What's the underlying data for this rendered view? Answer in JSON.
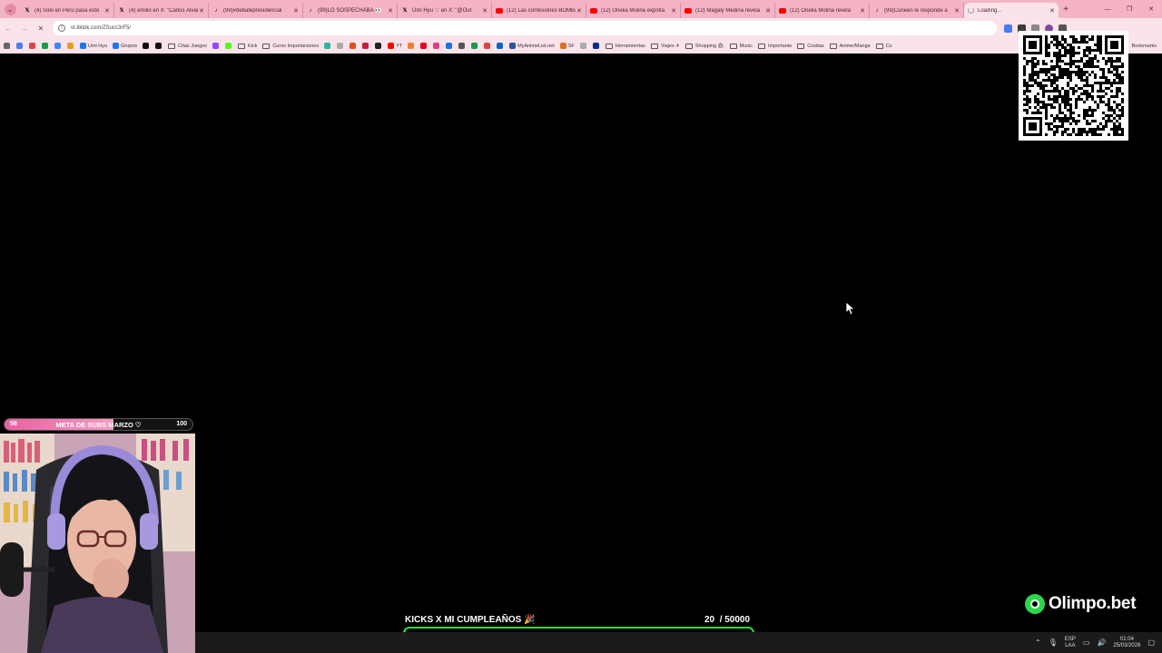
{
  "browser": {
    "tabs": [
      {
        "icon": "x",
        "title": "(4) Solo en Perú pasa esto"
      },
      {
        "icon": "x",
        "title": "(4) emilio en X: \"Carlos Álvarez"
      },
      {
        "icon": "tt",
        "title": "(99)#debatepresidencial"
      },
      {
        "icon": "tt",
        "title": "(99)LO SOSPECHABA 👀"
      },
      {
        "icon": "x",
        "title": "Umi Hyu ♡ en X: \"@Out"
      },
      {
        "icon": "yt",
        "title": "(12) Las confesiones BOMBA"
      },
      {
        "icon": "yt",
        "title": "(12) Onelia Molina explota"
      },
      {
        "icon": "yt",
        "title": "(12) Magaly Medina revela"
      },
      {
        "icon": "yt",
        "title": "(12) Onelia Molina revela"
      },
      {
        "icon": "tt",
        "title": "(99)Cuneen le responde a"
      },
      {
        "icon": "load",
        "title": "Loading...",
        "active": true
      }
    ],
    "address": "vt.tiktok.com/ZSucc3rF5/",
    "bookmarks": [
      {
        "kind": "icon",
        "color": "#4a7cf0"
      },
      {
        "kind": "icon",
        "color": "#d44"
      },
      {
        "kind": "icon",
        "color": "#1a9a4a"
      },
      {
        "kind": "icon",
        "color": "#4285f4"
      },
      {
        "kind": "icon",
        "color": "#e0a020"
      },
      {
        "kind": "link",
        "color": "#1877f2",
        "label": "Umi Hyu"
      },
      {
        "kind": "link",
        "color": "#1877f2",
        "label": "Grupos"
      },
      {
        "kind": "icon",
        "color": "#111"
      },
      {
        "kind": "icon",
        "color": "#111"
      },
      {
        "kind": "folder",
        "label": "Citas Juegos"
      },
      {
        "kind": "icon",
        "color": "#9146ff"
      },
      {
        "kind": "icon",
        "color": "#53fc18"
      },
      {
        "kind": "folder",
        "label": "Kick"
      },
      {
        "kind": "folder",
        "label": "Curso Importaciones"
      },
      {
        "kind": "icon",
        "color": "#2bb5a0"
      },
      {
        "kind": "icon",
        "color": "#aaa"
      },
      {
        "kind": "icon",
        "color": "#e05020"
      },
      {
        "kind": "icon",
        "color": "#c02040"
      },
      {
        "kind": "icon",
        "color": "#222"
      },
      {
        "kind": "link",
        "color": "#f00",
        "label": "YT"
      },
      {
        "kind": "icon",
        "color": "#f08030"
      },
      {
        "kind": "icon",
        "color": "#e60023"
      },
      {
        "kind": "icon",
        "color": "#e04080"
      },
      {
        "kind": "icon",
        "color": "#1a73e8"
      },
      {
        "kind": "icon",
        "color": "#555"
      },
      {
        "kind": "icon",
        "color": "#1a9a4a"
      },
      {
        "kind": "icon",
        "color": "#d44"
      },
      {
        "kind": "icon",
        "color": "#0a66c2"
      },
      {
        "kind": "link",
        "color": "#2e51a2",
        "label": "MyAnimeList.net"
      },
      {
        "kind": "link",
        "color": "#e07020",
        "label": "SF"
      },
      {
        "kind": "icon",
        "color": "#aaa"
      },
      {
        "kind": "icon",
        "color": "#003087"
      },
      {
        "kind": "folder",
        "label": "Herramientas"
      },
      {
        "kind": "folder",
        "label": "Viajes ✈"
      },
      {
        "kind": "folder",
        "label": "Shopping 🛍"
      },
      {
        "kind": "folder",
        "label": "Music"
      },
      {
        "kind": "folder",
        "label": "Importante"
      },
      {
        "kind": "folder",
        "label": "Cositas"
      },
      {
        "kind": "folder",
        "label": "Anime/Manga"
      },
      {
        "kind": "folder",
        "label": "Co"
      }
    ],
    "all_bookmarks": "Bookmarks"
  },
  "overlay": {
    "subs_goal": {
      "current": 58,
      "label": "META DE SUBS MARZO ♡",
      "target": 100,
      "progress": 0.58
    },
    "kicks_goal": {
      "label": "KICKS X MI CUMPLEAÑOS 🎉",
      "current": 20,
      "target": "/ 50000",
      "progress": 0.0004
    },
    "sponsor": "Olimpo.bet"
  },
  "taskbar": {
    "lang_top": "ESP",
    "lang_bottom": "LAA",
    "time": "01:04",
    "date": "25/03/2026"
  }
}
